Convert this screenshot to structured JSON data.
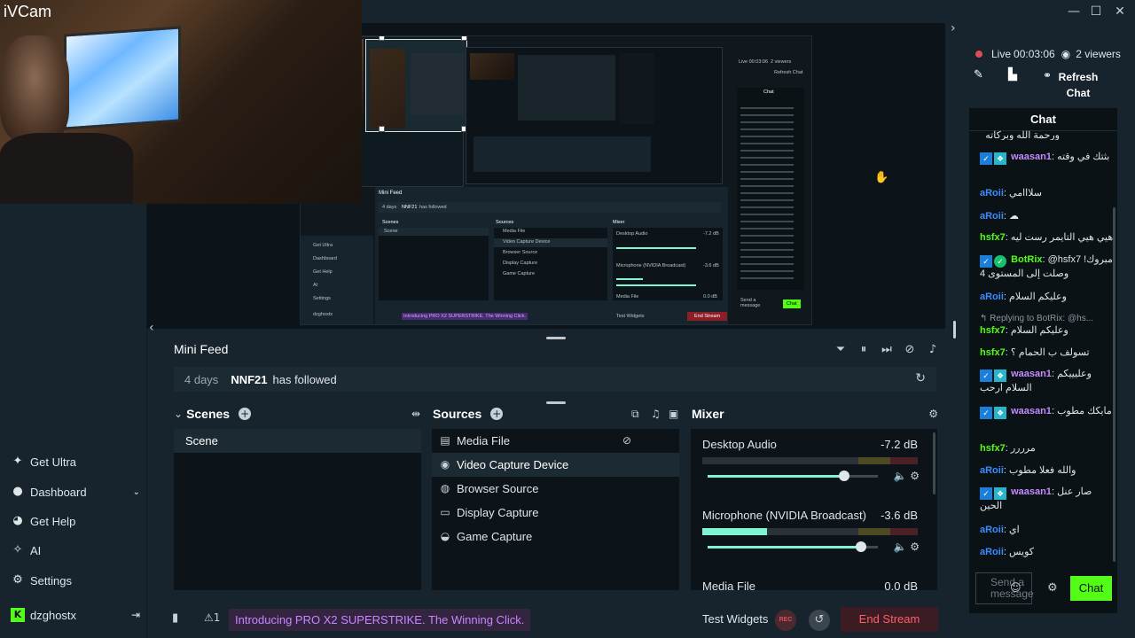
{
  "webcam": {
    "label": "iVCam"
  },
  "window": {
    "minimize": "—",
    "maximize": "☐",
    "close": "✕"
  },
  "sidebar": {
    "items": [
      {
        "label": "Get Ultra"
      },
      {
        "label": "Dashboard"
      },
      {
        "label": "Get Help"
      },
      {
        "label": "AI"
      },
      {
        "label": "Settings"
      }
    ],
    "user": "dzghostx"
  },
  "preview": {
    "chat_title": "Chat",
    "refresh_chat": "Refresh Chat",
    "live": "Live 00:03:06",
    "viewers": "2 viewers",
    "minifeed": "Mini Feed",
    "feed_days": "4 days",
    "feed_user": "NNF21",
    "feed_action": "has followed",
    "scenes": "Scenes",
    "sources": "Sources",
    "mixer": "Mixer",
    "scene": "Scene",
    "src1": "Media File",
    "src2": "Video Capture Device",
    "src3": "Browser Source",
    "src4": "Display Capture",
    "src5": "Game Capture",
    "desktop": "Desktop Audio",
    "desktop_db": "-7.2 dB",
    "mic": "Microphone (NVIDIA Broadcast)",
    "mic_db": "-3.6 dB",
    "media": "Media File",
    "media_db": "0.0 dB",
    "side1": "Get Ultra",
    "side2": "Dashboard",
    "side3": "Get Help",
    "side4": "AI",
    "side5": "Settings",
    "user": "dzghostx",
    "promo": "Introducing PRO X2 SUPERSTRIKE. The Winning Click.",
    "test": "Test Widgets",
    "end": "End Stream",
    "send": "Send a message",
    "chat_btn": "Chat"
  },
  "minifeed": {
    "title": "Mini Feed",
    "event": {
      "ago": "4 days",
      "user": "NNF21",
      "action": "has followed"
    }
  },
  "scenes": {
    "title": "Scenes",
    "items": [
      "Scene"
    ]
  },
  "sources": {
    "title": "Sources",
    "items": [
      {
        "label": "Media File",
        "icon": "film-icon"
      },
      {
        "label": "Video Capture Device",
        "icon": "webcam-icon"
      },
      {
        "label": "Browser Source",
        "icon": "globe-icon"
      },
      {
        "label": "Display Capture",
        "icon": "monitor-icon"
      },
      {
        "label": "Game Capture",
        "icon": "gamepad-icon"
      }
    ]
  },
  "mixer": {
    "title": "Mixer",
    "channels": [
      {
        "name": "Desktop Audio",
        "db": "-7.2 dB",
        "level": 0.0,
        "volume": 0.8
      },
      {
        "name": "Microphone (NVIDIA Broadcast)",
        "db": "-3.6 dB",
        "level": 0.3,
        "volume": 0.9
      },
      {
        "name": "Media File",
        "db": "0.0 dB"
      }
    ]
  },
  "footer": {
    "promo": "Introducing PRO X2 SUPERSTRIKE. The Winning Click.",
    "alert_count": "1",
    "test_widgets": "Test Widgets",
    "rec": "REC",
    "end_stream": "End Stream"
  },
  "stream": {
    "live": "Live",
    "time": "00:03:06",
    "viewers": "2 viewers"
  },
  "chat": {
    "refresh_label": "Refresh Chat",
    "title": "Chat",
    "messages": [
      {
        "user": "",
        "text": "ورحمة الله وبركاته"
      },
      {
        "user": "waasan1",
        "text": "بثتك في وقته",
        "color": "#c48bff"
      },
      {
        "user": "aRoii",
        "text": "سلااامي",
        "color": "#3c8cff"
      },
      {
        "user": "aRoii",
        "text": "",
        "color": "#3c8cff"
      },
      {
        "user": "hsfx7",
        "text": "هيي هيي التايمر رست ليه",
        "color": "#53fc18"
      },
      {
        "user": "BotRix",
        "text": "@hsfx7 مبروك! وصلت إلى المستوى 4",
        "color": "#53fc18"
      },
      {
        "user": "aRoii",
        "text": "وعليكم السلام",
        "color": "#3c8cff"
      },
      {
        "user": "hsfx7",
        "text": "وعليكم السلام",
        "color": "#53fc18",
        "reply": "Replying to BotRix: @hs..."
      },
      {
        "user": "hsfx7",
        "text": "تسولف ب الحمام ؟",
        "color": "#53fc18"
      },
      {
        "user": "waasan1",
        "text": "وعليييكم السلام ارحب",
        "color": "#c48bff"
      },
      {
        "user": "waasan1",
        "text": "مايكك مطوب",
        "color": "#c48bff"
      },
      {
        "user": "hsfx7",
        "text": "مرررر",
        "color": "#53fc18"
      },
      {
        "user": "aRoii",
        "text": "والله فعلا مطوب",
        "color": "#3c8cff"
      },
      {
        "user": "waasan1",
        "text": "صار عنل الحين",
        "color": "#c48bff"
      },
      {
        "user": "aRoii",
        "text": "اي",
        "color": "#3c8cff"
      },
      {
        "user": "aRoii",
        "text": "كويس",
        "color": "#3c8cff"
      }
    ],
    "input_placeholder": "Send a message",
    "send_button": "Chat"
  }
}
